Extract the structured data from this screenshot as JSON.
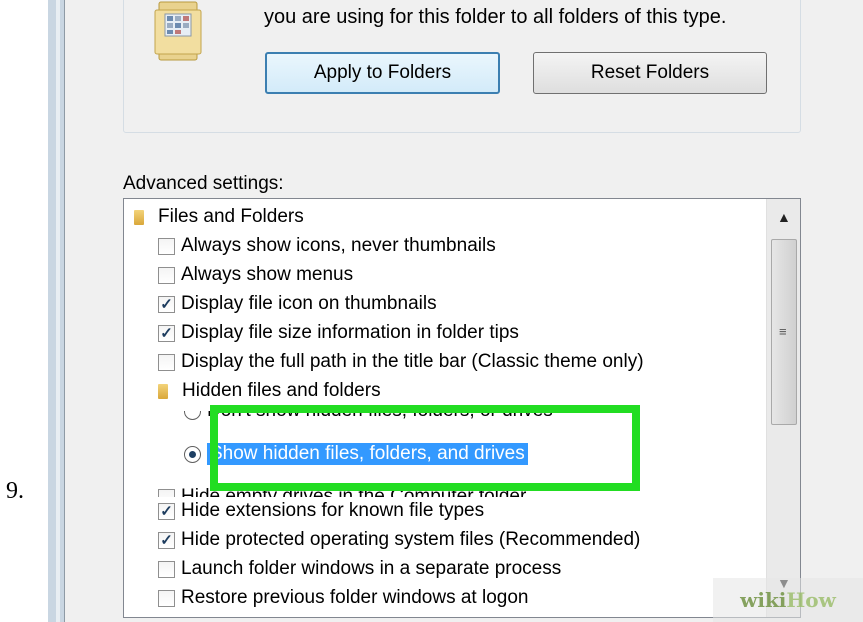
{
  "step": {
    "number": "9."
  },
  "folder_views": {
    "description": "you are using for this folder to all folders of this type.",
    "apply_button": "Apply to Folders",
    "reset_button": "Reset Folders"
  },
  "advanced": {
    "label": "Advanced settings:",
    "items": [
      {
        "kind": "folder",
        "label": "Files and Folders"
      },
      {
        "kind": "checkbox",
        "checked": false,
        "label": "Always show icons, never thumbnails"
      },
      {
        "kind": "checkbox",
        "checked": false,
        "label": "Always show menus"
      },
      {
        "kind": "checkbox",
        "checked": true,
        "label": "Display file icon on thumbnails"
      },
      {
        "kind": "checkbox",
        "checked": true,
        "label": "Display file size information in folder tips"
      },
      {
        "kind": "checkbox",
        "checked": false,
        "label": "Display the full path in the title bar (Classic theme only)"
      },
      {
        "kind": "folder",
        "label": "Hidden files and folders"
      },
      {
        "kind": "radio",
        "checked": false,
        "label": "Don't show hidden files, folders, or drives"
      },
      {
        "kind": "radio",
        "checked": true,
        "label": "Show hidden files, folders, and drives"
      },
      {
        "kind": "checkbox",
        "checked": false,
        "label": "Hide empty drives in the Computer folder"
      },
      {
        "kind": "checkbox",
        "checked": true,
        "label": "Hide extensions for known file types"
      },
      {
        "kind": "checkbox",
        "checked": true,
        "label": "Hide protected operating system files (Recommended)"
      },
      {
        "kind": "checkbox",
        "checked": false,
        "label": "Launch folder windows in a separate process"
      },
      {
        "kind": "checkbox",
        "checked": false,
        "label": "Restore previous folder windows at logon"
      }
    ]
  },
  "watermark": {
    "part1": "wiki",
    "part2": "How"
  },
  "colors": {
    "highlight": "#22dd22",
    "selection": "#3399ff"
  },
  "icons": {
    "check": "✓",
    "scroll_up": "▲",
    "scroll_down": "▼",
    "grip": "≡"
  }
}
